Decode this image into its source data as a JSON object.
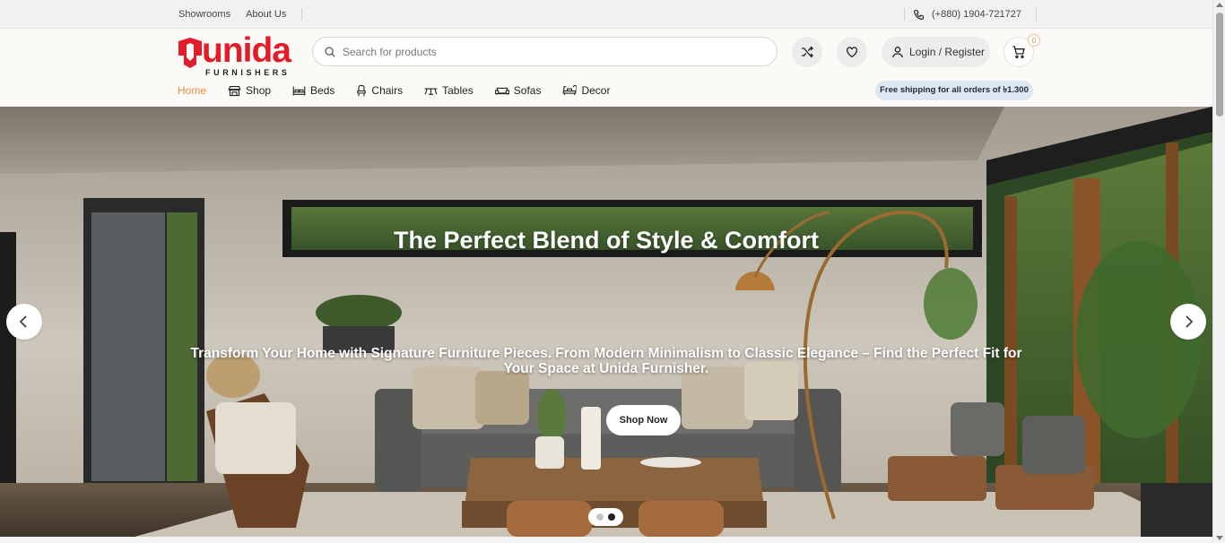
{
  "topbar": {
    "links": [
      "Showrooms",
      "About Us"
    ],
    "phone": "(+880) 1904-721727",
    "phone_icon": "phone-icon"
  },
  "brand": {
    "name": "unida",
    "tagline": "FURNISHERS",
    "color": "#e11d2a"
  },
  "search": {
    "placeholder": "Search for products",
    "value": ""
  },
  "header_actions": {
    "compare_icon": "shuffle-icon",
    "wishlist_icon": "heart-icon",
    "login_label": "Login / Register",
    "cart_count": "0"
  },
  "nav": {
    "items": [
      {
        "label": "Home",
        "icon": ""
      },
      {
        "label": "Shop",
        "icon": "shop-icon"
      },
      {
        "label": "Beds",
        "icon": "bed-icon"
      },
      {
        "label": "Chairs",
        "icon": "chair-icon"
      },
      {
        "label": "Tables",
        "icon": "table-icon"
      },
      {
        "label": "Sofas",
        "icon": "sofa-icon"
      },
      {
        "label": "Decor",
        "icon": "decor-icon"
      }
    ],
    "active": "Home",
    "accent": "#ef8a3c",
    "promo": "Free shipping for all orders of ৳1.300"
  },
  "hero": {
    "title": "The Perfect Blend of Style & Comfort",
    "subtitle": "Transform Your Home with Signature Furniture Pieces. From Modern Minimalism to Classic Elegance – Find the Perfect Fit for Your Space at Unida Furnisher.",
    "cta": "Shop Now",
    "slides": 2,
    "active_slide": 2
  }
}
